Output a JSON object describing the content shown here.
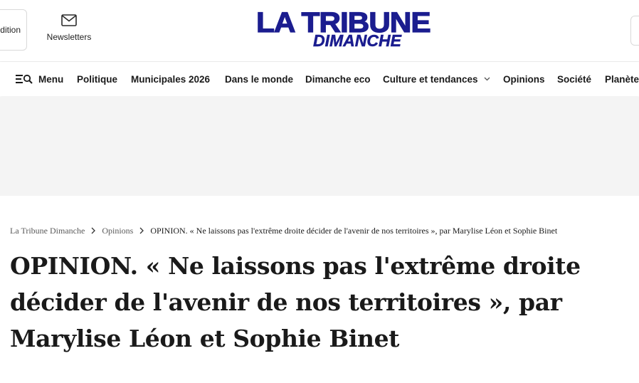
{
  "header": {
    "edition_label": "Edition",
    "newsletters_label": "Newsletters",
    "logo_line1": "LA TRIBUNE",
    "logo_line2": "DIMANCHE"
  },
  "nav": {
    "menu_label": "Menu",
    "items": [
      "Politique",
      "Municipales 2026",
      "Dans le monde",
      "Dimanche eco",
      "Culture et tendances",
      "Opinions",
      "Société",
      "Planète"
    ]
  },
  "breadcrumb": {
    "items": [
      "La Tribune Dimanche",
      "Opinions"
    ],
    "current": "OPINION. « Ne laissons pas l'extrême droite décider de l'avenir de nos territoires », par Marylise Léon et Sophie Binet"
  },
  "article": {
    "title": "OPINION. « Ne laissons pas l'extrême droite décider de l'avenir de nos territoires », par Marylise Léon et Sophie Binet"
  },
  "colors": {
    "brand": "#1b1d8f",
    "ad_background": "#f4f4f4"
  },
  "icons": [
    "mail-icon",
    "menu-search-icon",
    "chevron-down-icon",
    "chevron-right-icon"
  ]
}
